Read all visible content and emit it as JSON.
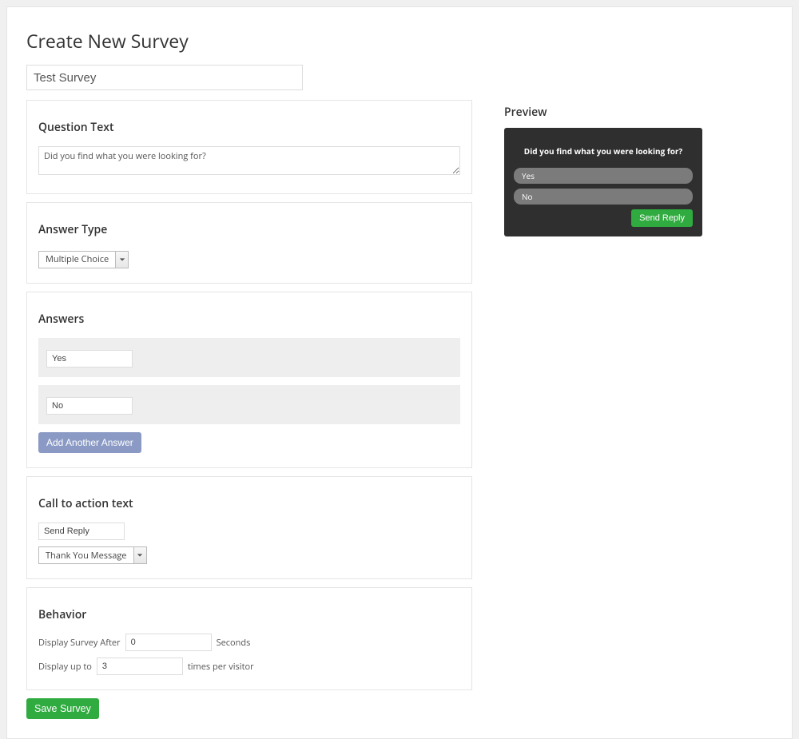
{
  "page_title": "Create New Survey",
  "survey_title": "Test Survey",
  "question": {
    "heading": "Question Text",
    "text": "Did you find what you were looking for?"
  },
  "answer_type": {
    "heading": "Answer Type",
    "selected": "Multiple Choice"
  },
  "answers": {
    "heading": "Answers",
    "items": [
      "Yes",
      "No"
    ],
    "add_label": "Add Another Answer"
  },
  "cta": {
    "heading": "Call to action text",
    "value": "Send Reply",
    "message_type": "Thank You Message"
  },
  "behavior": {
    "heading": "Behavior",
    "after_label": "Display Survey After",
    "after_value": "0",
    "after_suffix": "Seconds",
    "upto_label": "Display up to",
    "upto_value": "3",
    "upto_suffix": "times per visitor"
  },
  "save_label": "Save Survey",
  "preview": {
    "heading": "Preview",
    "question": "Did you find what you were looking for?",
    "options": [
      "Yes",
      "No"
    ],
    "button_label": "Send Reply"
  }
}
